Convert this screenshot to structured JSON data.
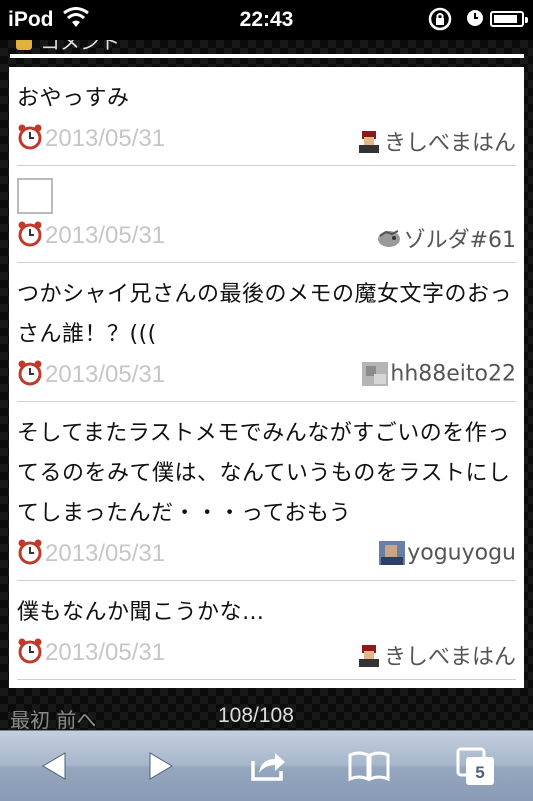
{
  "status_bar": {
    "carrier": "iPod",
    "time": "22:43",
    "battery_level": 0.9
  },
  "section": {
    "title": "コメント"
  },
  "comments": [
    {
      "text": "おやっすみ",
      "date": "2013/05/31",
      "user": "きしべまはん",
      "avatar": "character-avatar-icon"
    },
    {
      "text": "",
      "date": "2013/05/31",
      "user": "ゾルダ#61",
      "avatar": "dragon-avatar-icon"
    },
    {
      "text": "つかシャイ兄さんの最後のメモの魔女文字のおっさん誰！？(((",
      "date": "2013/05/31",
      "user": "hh88eito22",
      "avatar": "gray-avatar-icon"
    },
    {
      "text": "そしてまたラストメモでみんながすごいのを作ってるのをみて僕は、なんていうものをラストにしてしまったんだ・・・っておもう",
      "date": "2013/05/31",
      "user": "yoguyogu",
      "avatar": "blue-avatar-icon"
    },
    {
      "text": "僕もなんか聞こうかな…",
      "date": "2013/05/31",
      "user": "きしべまはん",
      "avatar": "character-avatar-icon"
    }
  ],
  "pager": {
    "first": "最初",
    "prev": "前へ",
    "count": "108/108"
  },
  "toolbar": {
    "tabs_count": "5",
    "icons": [
      "back-arrow-icon",
      "forward-arrow-icon",
      "share-icon",
      "bookmarks-icon",
      "tabs-icon"
    ]
  }
}
